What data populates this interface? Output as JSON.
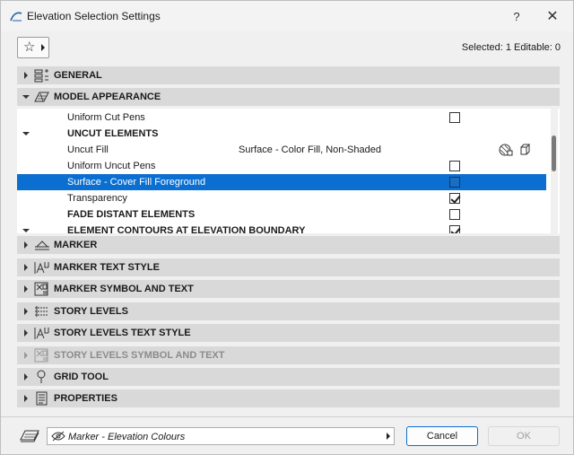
{
  "window": {
    "title": "Elevation Selection Settings",
    "help_glyph": "?",
    "close_glyph": "✕"
  },
  "favorites": {
    "star_glyph": "☆"
  },
  "selection_info": "Selected: 1 Editable: 0",
  "panels_top": [
    {
      "label": "GENERAL",
      "icon": "general-settings-icon",
      "expanded": false
    },
    {
      "label": "MODEL APPEARANCE",
      "icon": "model-appearance-icon",
      "expanded": true
    }
  ],
  "model_appearance": {
    "rows": [
      {
        "name": "Uniform Cut Pens",
        "value": "",
        "checkbox": "unchecked"
      },
      {
        "name": "UNCUT ELEMENTS",
        "section": true
      },
      {
        "name": "Uncut Fill",
        "value": "Surface - Color Fill, Non-Shaded",
        "icons": [
          "fill-settings-icon",
          "3d-surface-icon"
        ]
      },
      {
        "name": "Uniform Uncut Pens",
        "value": "",
        "checkbox": "unchecked"
      },
      {
        "name": "Surface - Cover Fill Foreground",
        "value": "",
        "checkbox": "unchecked",
        "selected": true
      },
      {
        "name": "Transparency",
        "value": "",
        "checkbox": "checked"
      },
      {
        "name": "FADE DISTANT ELEMENTS",
        "section_bold": true,
        "checkbox": "unchecked"
      },
      {
        "name": "ELEMENT CONTOURS AT ELEVATION BOUNDARY",
        "section": true,
        "checkbox": "checked"
      }
    ]
  },
  "panels_bottom": [
    {
      "label": "MARKER",
      "icon": "marker-icon",
      "disabled": false
    },
    {
      "label": "MARKER TEXT STYLE",
      "icon": "text-style-icon",
      "disabled": false
    },
    {
      "label": "MARKER SYMBOL AND TEXT",
      "icon": "symbol-text-icon",
      "disabled": false
    },
    {
      "label": "STORY LEVELS",
      "icon": "story-levels-icon",
      "disabled": false
    },
    {
      "label": "STORY LEVELS TEXT STYLE",
      "icon": "text-style-icon",
      "disabled": false
    },
    {
      "label": "STORY LEVELS SYMBOL AND TEXT",
      "icon": "symbol-text-icon",
      "disabled": true
    },
    {
      "label": "GRID TOOL",
      "icon": "grid-tool-icon",
      "disabled": false
    },
    {
      "label": "PROPERTIES",
      "icon": "properties-icon",
      "disabled": false
    }
  ],
  "footer": {
    "override": "Marker - Elevation Colours",
    "cancel": "Cancel",
    "ok": "OK"
  },
  "colors": {
    "selection": "#0a6fd1",
    "panel_header": "#d9d9d9",
    "accent_border": "#0a6fd1"
  }
}
